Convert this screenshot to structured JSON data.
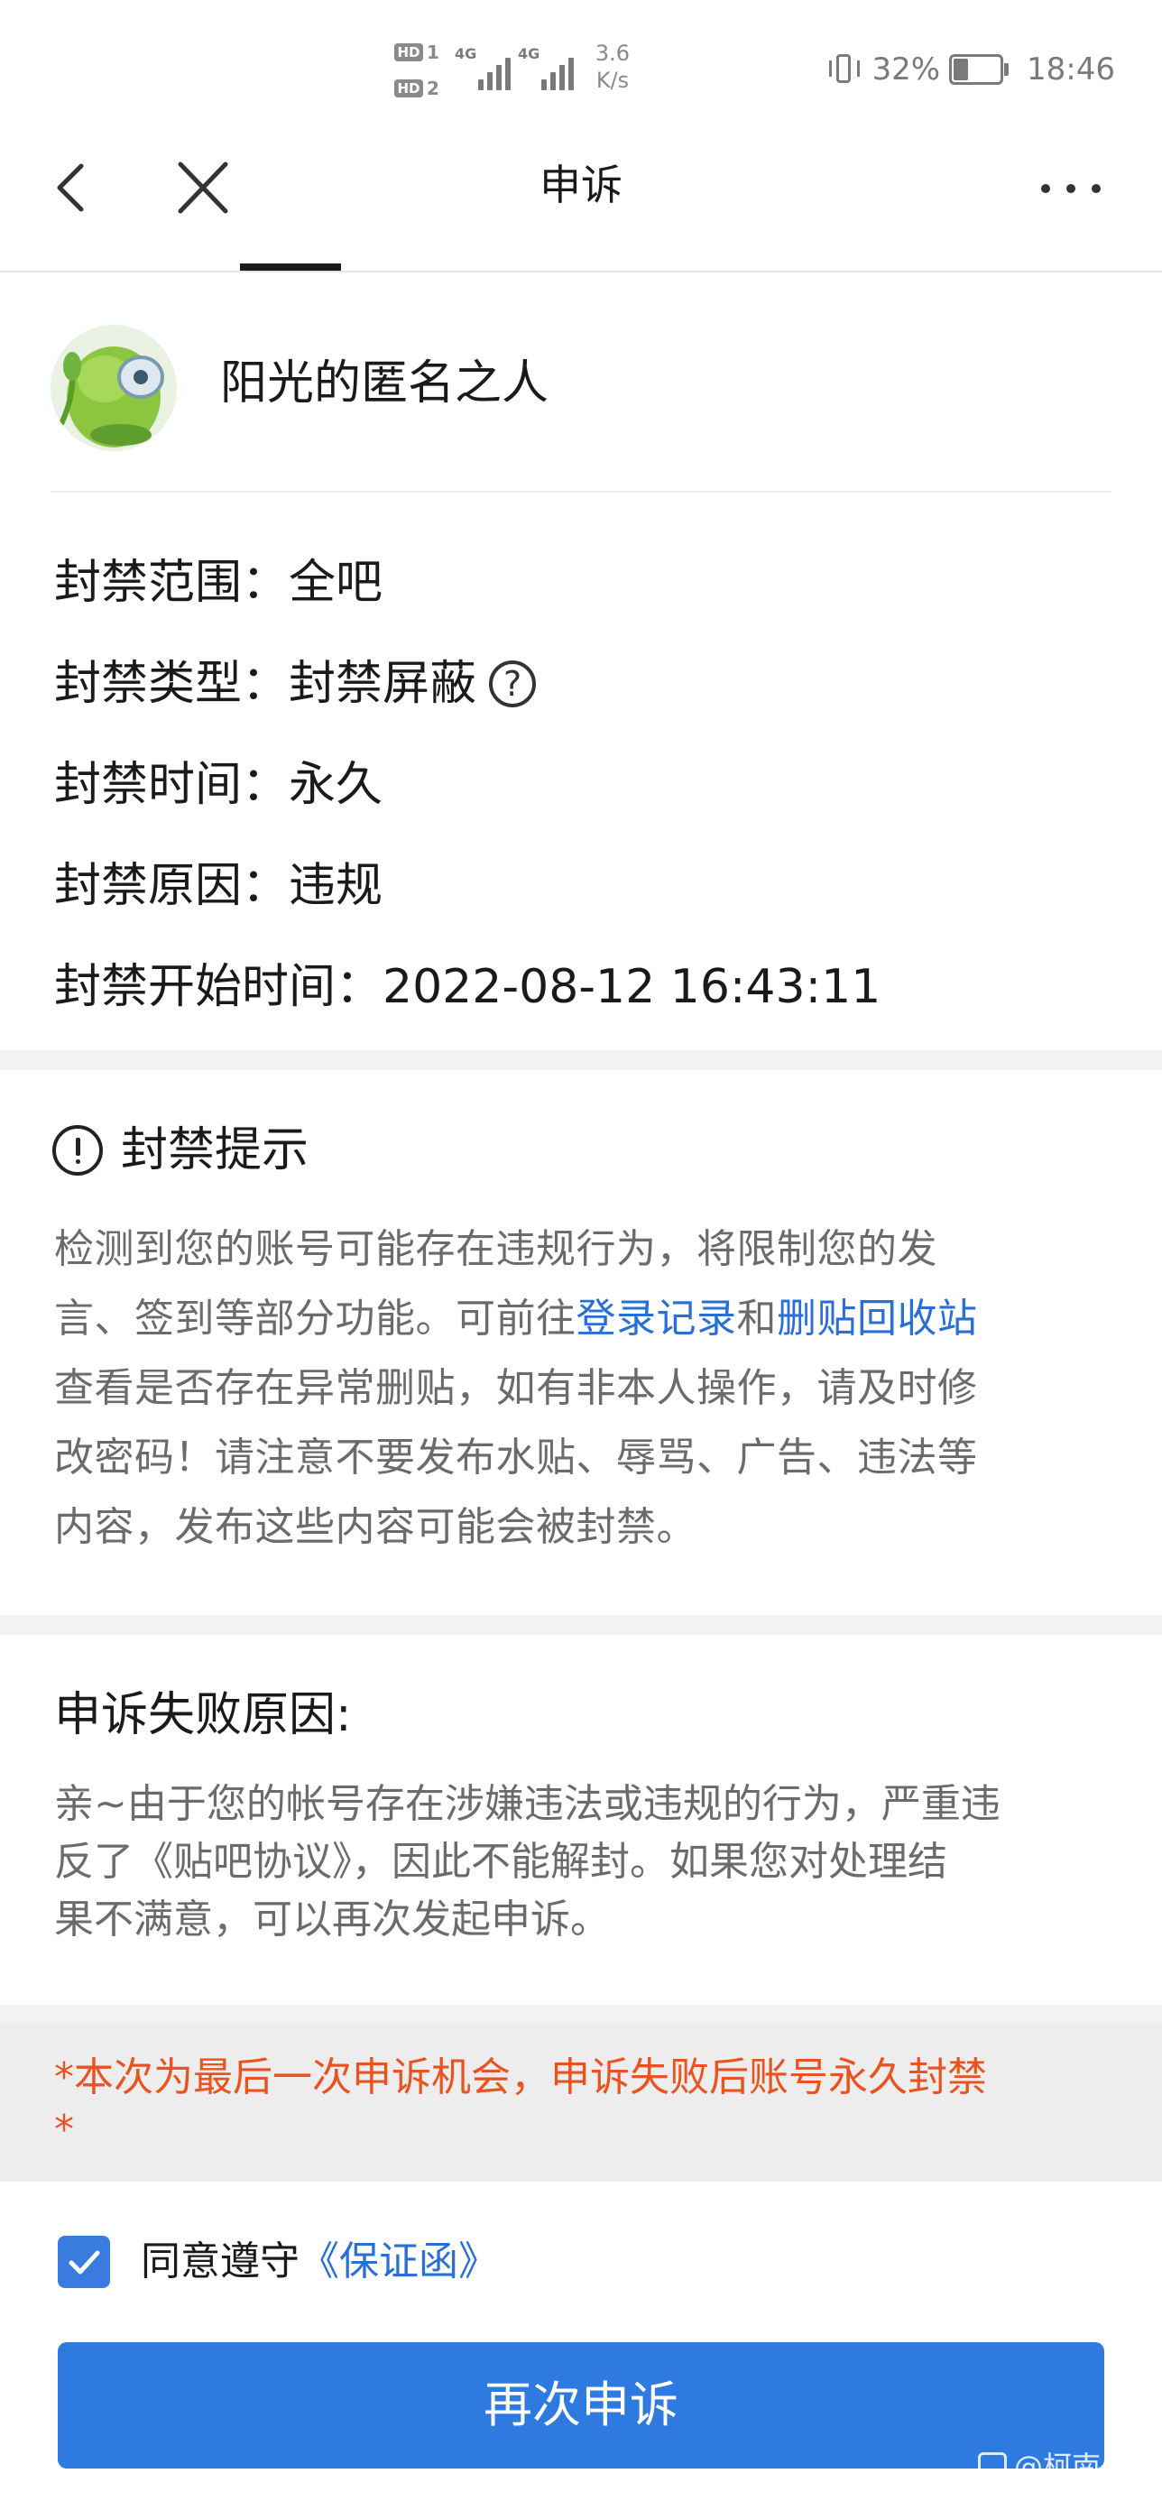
{
  "status_bar": {
    "hd1": "HD",
    "hd1_num": "1",
    "hd2": "HD",
    "hd2_num": "2",
    "net1": "4G",
    "net2": "4G",
    "speed_value": "3.6",
    "speed_unit": "K/s",
    "battery_percent": "32%",
    "battery_level": 0.32,
    "time": "18:46",
    "icons": [
      "vibrate-icon",
      "battery-icon",
      "signal-icon"
    ]
  },
  "nav": {
    "title": "申诉",
    "back_icon": "chevron-left-icon",
    "close_icon": "close-icon",
    "more_icon": "more-horizontal-icon"
  },
  "user": {
    "name": "阳光的匿名之人"
  },
  "ban_info": {
    "scope_label": "封禁范围：",
    "scope_value": "全吧",
    "type_label": "封禁类型：",
    "type_value": "封禁屏蔽",
    "type_help_glyph": "?",
    "time_label": "封禁时间：",
    "time_value": "永久",
    "reason_label": "封禁原因：",
    "reason_value": "违规",
    "start_label": "封禁开始时间：",
    "start_value": "2022-08-12 16:43:11"
  },
  "ban_tip": {
    "title": "封禁提示",
    "line1": "检测到您的账号可能存在违规行为，将限制您的发",
    "line2_pre": "言、签到等部分功能。可前往",
    "link_login": "登录记录",
    "line2_mid": "和",
    "link_recycle": "删贴回收站",
    "line3": "查看是否存在异常删贴，如有非本人操作，请及时修",
    "line4": "改密码！请注意不要发布水贴、辱骂、广告、违法等",
    "line5": "内容，发布这些内容可能会被封禁。"
  },
  "fail_reason": {
    "title": "申诉失败原因:",
    "line1": "亲~由于您的帐号存在涉嫌违法或违规的行为，严重违",
    "line2": "反了《贴吧协议》，因此不能解封。如果您对处理结",
    "line3": "果不满意，可以再次发起申诉。"
  },
  "warning": {
    "line1": "*本次为最后一次申诉机会，申诉失败后账号永久封禁",
    "line2": "*"
  },
  "agreement": {
    "checked": true,
    "label": "同意遵守",
    "link": "《保证函》"
  },
  "submit": {
    "label": "再次申诉"
  },
  "watermark": {
    "text": "@柯南"
  },
  "colors": {
    "accent_blue": "#2f7ae0",
    "link_blue": "#2a6fd6",
    "warning_orange": "#e8531f",
    "muted_text": "#6b6b6b"
  }
}
